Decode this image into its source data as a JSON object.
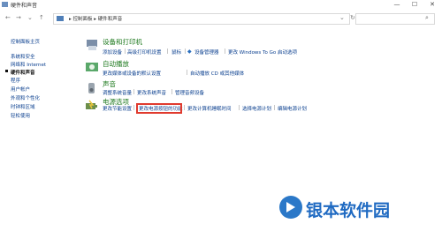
{
  "window": {
    "title": "硬件和声音",
    "minimize_glyph": "—",
    "maximize_glyph": "☐",
    "close_glyph": "✕"
  },
  "address": {
    "breadcrumb": "▸ 控制面板 ▸ 硬件和声音",
    "breadcrumb_parts": [
      "控制面板",
      "硬件和声音"
    ],
    "search_placeholder": ""
  },
  "sidebar": {
    "items": [
      {
        "label": "控制面板主页",
        "current": false
      },
      {
        "label": "系统和安全",
        "current": false
      },
      {
        "label": "网络和 Internet",
        "current": false
      },
      {
        "label": "硬件和声音",
        "current": true
      },
      {
        "label": "程序",
        "current": false
      },
      {
        "label": "用户帐户",
        "current": false
      },
      {
        "label": "外观和个性化",
        "current": false
      },
      {
        "label": "时钟和区域",
        "current": false
      },
      {
        "label": "轻松使用",
        "current": false
      }
    ]
  },
  "categories": [
    {
      "title": "设备和打印机",
      "icon": "printer-icon",
      "links": [
        "添加设备",
        "高级打印机设置",
        "鼠标",
        "设备管理器",
        "更改 Windows To Go 启动选项"
      ]
    },
    {
      "title": "自动播放",
      "icon": "autoplay-icon",
      "links": [
        "更改媒体或设备的默认设置",
        "自动播放 CD 或其他媒体"
      ]
    },
    {
      "title": "声音",
      "icon": "speaker-icon",
      "links": [
        "调整系统音量",
        "更改系统声音",
        "管理音频设备"
      ]
    },
    {
      "title": "电源选项",
      "icon": "power-options-icon",
      "links": [
        "更改节能设置",
        "更改电源按钮的功能",
        "更改计算机睡眠时间",
        "选择电源计划",
        "编辑电源计划"
      ]
    }
  ],
  "highlighted_link": "更改电源按钮的功能",
  "watermark": {
    "text": "银本软件园",
    "color": "#1f6ac2"
  },
  "colors": {
    "category_title": "#1f7a1f",
    "link": "#0a3f8f",
    "highlight_border": "#e03a2e"
  }
}
